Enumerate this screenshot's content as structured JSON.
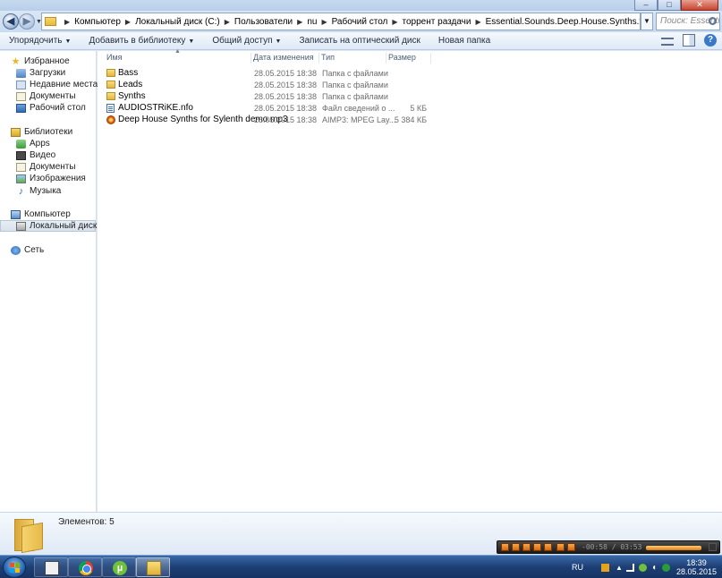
{
  "address_bar": {
    "breadcrumbs": [
      "Компьютер",
      "Локальный диск (C:)",
      "Пользователи",
      "nu",
      "Рабочий стол",
      "торрент раздачи",
      "Essential.Sounds.Deep.House.Synths.for.Sylenth-AUDIOSTRiKE"
    ],
    "search_placeholder": "Поиск: Essenti..."
  },
  "toolbar": {
    "organize": "Упорядочить",
    "add_to_library": "Добавить в библиотеку",
    "share": "Общий доступ",
    "burn": "Записать на оптический диск",
    "new_folder": "Новая папка"
  },
  "nav": {
    "favorites": "Избранное",
    "downloads": "Загрузки",
    "recent": "Недавние места",
    "documents": "Документы",
    "desktop": "Рабочий стол",
    "libraries": "Библиотеки",
    "apps": "Apps",
    "video": "Видео",
    "lib_documents": "Документы",
    "images": "Изображения",
    "music": "Музыка",
    "computer": "Компьютер",
    "local_disk": "Локальный диск (C:)",
    "network": "Сеть"
  },
  "columns": {
    "name": "Имя",
    "date": "Дата изменения",
    "type": "Тип",
    "size": "Размер"
  },
  "files": [
    {
      "name": "Bass",
      "date": "28.05.2015 18:38",
      "type": "Папка с файлами",
      "size": "",
      "icon": "folder-icon"
    },
    {
      "name": "Leads",
      "date": "28.05.2015 18:38",
      "type": "Папка с файлами",
      "size": "",
      "icon": "folder-icon"
    },
    {
      "name": "Synths",
      "date": "28.05.2015 18:38",
      "type": "Папка с файлами",
      "size": "",
      "icon": "folder-icon"
    },
    {
      "name": "AUDIOSTRiKE.nfo",
      "date": "28.05.2015 18:38",
      "type": "Файл сведений о ...",
      "size": "5 КБ",
      "icon": "nfo-file-icon"
    },
    {
      "name": "Deep House Synths for Sylenth demo.mp3",
      "date": "28.05.2015 18:38",
      "type": "AIMP3: MPEG Lay...",
      "size": "5 384 КБ",
      "icon": "mp3-file-icon"
    }
  ],
  "details": {
    "item_count": "Элементов: 5"
  },
  "player": {
    "time": "-00:58 / 03:53"
  },
  "taskbar": {
    "language": "RU",
    "time": "18:39",
    "date": "28.05.2015"
  },
  "colors": {
    "taskbar": "#1d3f75",
    "folder": "#e6b640",
    "selection": "#d8e2ed"
  }
}
